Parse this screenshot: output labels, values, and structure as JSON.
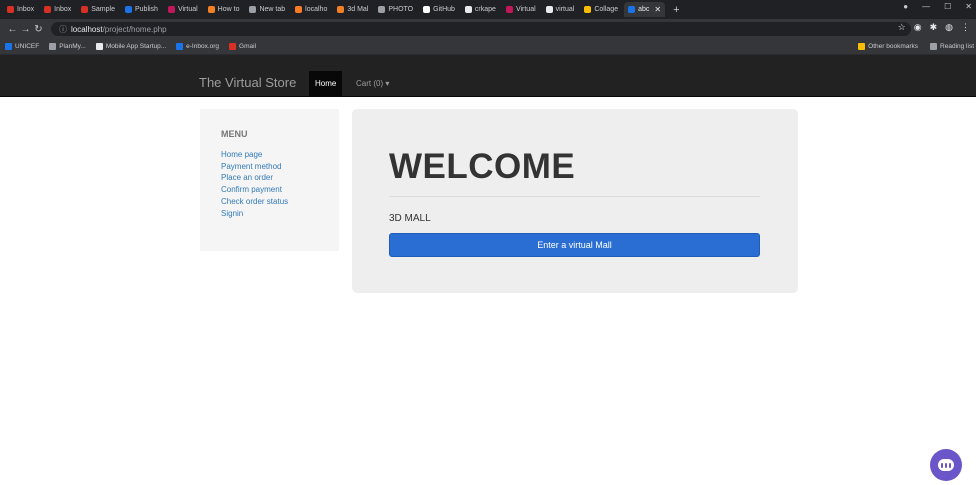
{
  "browser": {
    "tabs": [
      {
        "label": "Inbox",
        "icon": "gmail-icon",
        "color": "#d93025"
      },
      {
        "label": "Inbox",
        "icon": "gmail-icon",
        "color": "#d93025"
      },
      {
        "label": "Sample",
        "icon": "gmail-icon",
        "color": "#d93025"
      },
      {
        "label": "Publish",
        "icon": "globe-icon",
        "color": "#1a73e8"
      },
      {
        "label": "Virtual",
        "icon": "site-icon",
        "color": "#c2185b"
      },
      {
        "label": "How to",
        "icon": "stack-icon",
        "color": "#f48024"
      },
      {
        "label": "New tab",
        "icon": "page-icon",
        "color": "#9aa0a6"
      },
      {
        "label": "localho",
        "icon": "xampp-icon",
        "color": "#fb7a24"
      },
      {
        "label": "3d Mal",
        "icon": "stack-icon",
        "color": "#f48024"
      },
      {
        "label": "PHOTO",
        "icon": "globe-icon",
        "color": "#9aa0a6"
      },
      {
        "label": "GitHub",
        "icon": "github-icon",
        "color": "#ffffff"
      },
      {
        "label": "crkape",
        "icon": "chrome-icon",
        "color": "#e8eaed"
      },
      {
        "label": "Virtual",
        "icon": "site-icon",
        "color": "#c2185b"
      },
      {
        "label": "virtual",
        "icon": "chrome-icon",
        "color": "#e8eaed"
      },
      {
        "label": "Collage",
        "icon": "folder-icon",
        "color": "#fbbc04"
      },
      {
        "label": "abc",
        "icon": "site-icon",
        "color": "#1a73e8",
        "active": true
      }
    ],
    "new_tab": "+",
    "url_host": "localhost",
    "url_path": "/project/home.php",
    "bookmarks": [
      {
        "label": "UNICEF",
        "color": "#1a73e8"
      },
      {
        "label": "PlanMy...",
        "color": "#9aa0a6"
      },
      {
        "label": "Mobile App Startup...",
        "color": "#e8eaed"
      },
      {
        "label": "e-Inbox.org",
        "color": "#1a73e8"
      },
      {
        "label": "Gmail",
        "color": "#d93025"
      }
    ],
    "bookmarks_right": [
      {
        "label": "Other bookmarks",
        "color": "#fbbc04"
      },
      {
        "label": "Reading list",
        "color": "#9aa0a6"
      }
    ]
  },
  "site": {
    "brand": "The Virtual Store",
    "nav_home": "Home",
    "nav_cart": "Cart (0) ▾"
  },
  "menu": {
    "title": "MENU",
    "items": [
      "Home page",
      "Payment method",
      "Place an order",
      "Confirm payment",
      "Check order status",
      "Signin"
    ]
  },
  "jumbotron": {
    "title": "WELCOME",
    "subtitle": "3D MALL",
    "button": "Enter a virtual Mall"
  },
  "colors": {
    "navbar": "#222222",
    "link": "#337ab7",
    "button": "#2a6ed3",
    "chat": "#6a55c9"
  }
}
